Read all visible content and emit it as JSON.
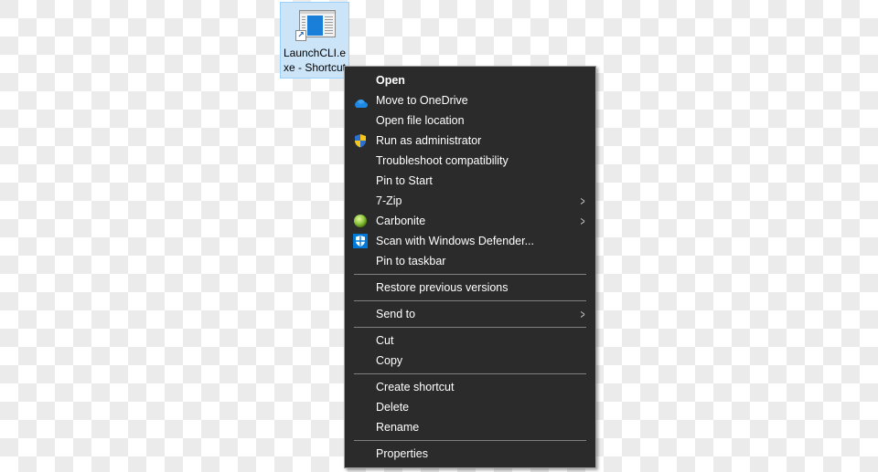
{
  "desktop_icon": {
    "label": "LaunchCLI.exe - Shortcut",
    "icon": "application-window-icon",
    "overlay": "shortcut-arrow-icon",
    "overlay_glyph": "↗"
  },
  "context_menu": {
    "groups": [
      [
        {
          "label": "Open",
          "bold": true
        },
        {
          "label": "Move to OneDrive",
          "icon": "onedrive-icon"
        },
        {
          "label": "Open file location"
        },
        {
          "label": "Run as administrator",
          "icon": "uac-shield-icon"
        },
        {
          "label": "Troubleshoot compatibility"
        },
        {
          "label": "Pin to Start"
        },
        {
          "label": "7-Zip",
          "submenu": true
        },
        {
          "label": "Carbonite",
          "icon": "carbonite-icon",
          "submenu": true
        },
        {
          "label": "Scan with Windows Defender...",
          "icon": "windows-defender-icon"
        },
        {
          "label": "Pin to taskbar"
        }
      ],
      [
        {
          "label": "Restore previous versions"
        }
      ],
      [
        {
          "label": "Send to",
          "submenu": true
        }
      ],
      [
        {
          "label": "Cut"
        },
        {
          "label": "Copy"
        }
      ],
      [
        {
          "label": "Create shortcut"
        },
        {
          "label": "Delete"
        },
        {
          "label": "Rename"
        }
      ],
      [
        {
          "label": "Properties"
        }
      ]
    ],
    "submenu_glyph": ">"
  },
  "colors": {
    "menu_bg": "#2b2b2b",
    "menu_text": "#ffffff",
    "selection_bg": "#cce4f7",
    "onedrive_blue": "#1e88e5",
    "defender_blue": "#0078d7",
    "carbonite_green": "#8cc63f"
  }
}
